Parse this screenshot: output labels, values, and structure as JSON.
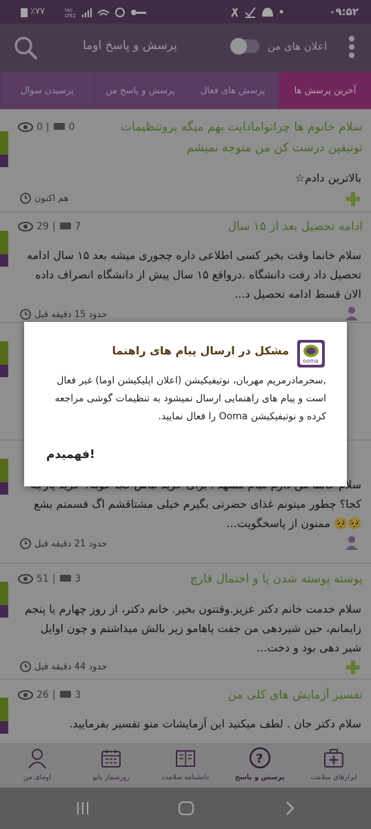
{
  "status_bar": {
    "time": "۰۹:۵۲",
    "battery": "٪۷۷",
    "network": "Vo) LTE2"
  },
  "app_bar": {
    "title": "پرسش و پاسخ اوما",
    "notifications_label": "اعلان های من"
  },
  "tabs": [
    {
      "label": "آخرین پرسش ها",
      "active": true
    },
    {
      "label": "پرسش های فعال",
      "active": false
    },
    {
      "label": "پرسش و پاسخ من",
      "active": false
    },
    {
      "label": "پرسیدن سوال",
      "active": false
    }
  ],
  "questions": [
    {
      "title_line1": "سلام خانوم ها چراتوامادایت بهم میگه بروتنظیمات",
      "title_line2": "نوتیفین درست کن من متوجه نمیشم",
      "body": "بالاترین دادم☆",
      "comments": "0",
      "views": "0",
      "time": "هم اکنون"
    },
    {
      "title_line1": "ادامه تحصیل بعد از ۱۵ سال",
      "body_line1": "سلام خانما وقت بخیر کسی اطلاعی داره چجوری میشه بعد ۱۵ سال ادامه",
      "body_line2": "تحصیل داد رفت دانشگاه .درواقع ۱۵ سال پیش از دانشگاه انصراف داده",
      "body_line3": "الان قسط ادامه تحصیل د...",
      "comments": "7",
      "views": "29",
      "time": "حدود 15 دقیقه قبل"
    },
    {
      "body_line1": "سلام خانما من دارم میام مشهد . برای خرید لباس کجا خوبه؟ خرید پارچه",
      "body_line2": "کجا؟ چطور میتونم غذای حضرتی بگیرم خیلی مشتاقشم اگ قسمتم بشع",
      "body_line3": "🥺🥺 ممنون از پاسخگویت...",
      "time": "حدود 21 دقیقه قبل"
    },
    {
      "title_line1": "پوسته پوسته شدن پا و احتمال قارچ",
      "body_line1": "سلام خدمت خانم دکتر عزیز.وقتتون بخیر. خانم دکتر، از روز چهارم یا پنجم",
      "body_line2": "زایمانم، حین شیردهی من جفت پاهامو زیر بالش میذاشتم و چون اوایل",
      "body_line3": "شیر دهی بود و دخت...",
      "comments": "3",
      "views": "51",
      "time": "حدود 44 دقیقه قبل"
    },
    {
      "title_line1": "تفسیر آزمایش های کلی من",
      "body_line1": "سلام دکتر جان . لطف میکنید این آزمایشات منو تفسیر بفرمایید.",
      "comments": "3",
      "views": "26"
    }
  ],
  "dialog": {
    "title": "مشکل در ارسال پیام های راهنما",
    "logo_text": "ooma",
    "body": ",سحرمادرمریم مهربان، نوتیفیکیشن (اعلان اپلیکیشن اوما) غیر فعال است و پیام های راهنمایی ارسال نمیشود به تنظیمات گوشی مراجعه کرده و نوتیفیکیشن Ooma را فعال نمایید.",
    "button": "فهمیدم!"
  },
  "bottom_nav": [
    {
      "label": "ابزارهای سلامت",
      "icon": "medical-kit-icon",
      "active": false
    },
    {
      "label": "پرسش و پاسخ",
      "icon": "question-bubble-icon",
      "active": true
    },
    {
      "label": "دانشنامه سلامت",
      "icon": "book-icon",
      "active": false
    },
    {
      "label": "روزشمار بانو",
      "icon": "calendar-icon",
      "active": false
    },
    {
      "label": "اومای من",
      "icon": "user-icon",
      "active": false
    }
  ],
  "colors": {
    "app_bar": "#6f5a78",
    "tabs": "#8a5a98",
    "active_tab": "#b03a8e",
    "title_green": "#6ea13a",
    "accent_purple": "#6b3b7d"
  }
}
